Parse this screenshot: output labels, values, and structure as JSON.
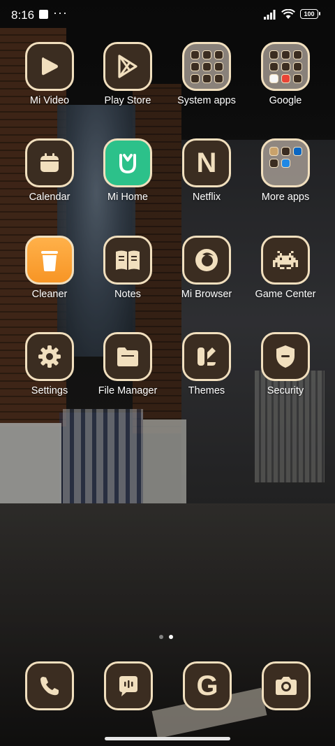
{
  "status_bar": {
    "time": "8:16",
    "more": "···",
    "battery": "100"
  },
  "colors": {
    "icon_background": "#3b2d21",
    "icon_border": "#f1dfbe",
    "mi_home_green": "#2cc18a",
    "cleaner_orange": "#f79525"
  },
  "apps": {
    "row1": [
      {
        "label": "Mi Video",
        "icon": "play-icon"
      },
      {
        "label": "Play Store",
        "icon": "play-store-icon"
      },
      {
        "label": "System apps",
        "icon": "folder-icon"
      },
      {
        "label": "Google",
        "icon": "folder-icon"
      }
    ],
    "row2": [
      {
        "label": "Calendar",
        "icon": "calendar-icon"
      },
      {
        "label": "Mi Home",
        "icon": "mi-home-icon"
      },
      {
        "label": "Netflix",
        "icon": "netflix-icon"
      },
      {
        "label": "More apps",
        "icon": "folder-icon"
      }
    ],
    "row3": [
      {
        "label": "Cleaner",
        "icon": "trash-icon"
      },
      {
        "label": "Notes",
        "icon": "book-icon"
      },
      {
        "label": "Mi Browser",
        "icon": "browser-icon"
      },
      {
        "label": "Game Center",
        "icon": "space-invader-icon"
      }
    ],
    "row4": [
      {
        "label": "Settings",
        "icon": "gear-icon"
      },
      {
        "label": "File Manager",
        "icon": "file-folder-icon"
      },
      {
        "label": "Themes",
        "icon": "themes-icon"
      },
      {
        "label": "Security",
        "icon": "shield-icon"
      }
    ]
  },
  "netflix_letter": "N",
  "page_indicator": {
    "pages": 2,
    "active": 2
  },
  "dock": [
    {
      "icon": "phone-icon"
    },
    {
      "icon": "messages-icon"
    },
    {
      "icon": "google-g-icon",
      "letter": "G"
    },
    {
      "icon": "camera-icon"
    }
  ]
}
